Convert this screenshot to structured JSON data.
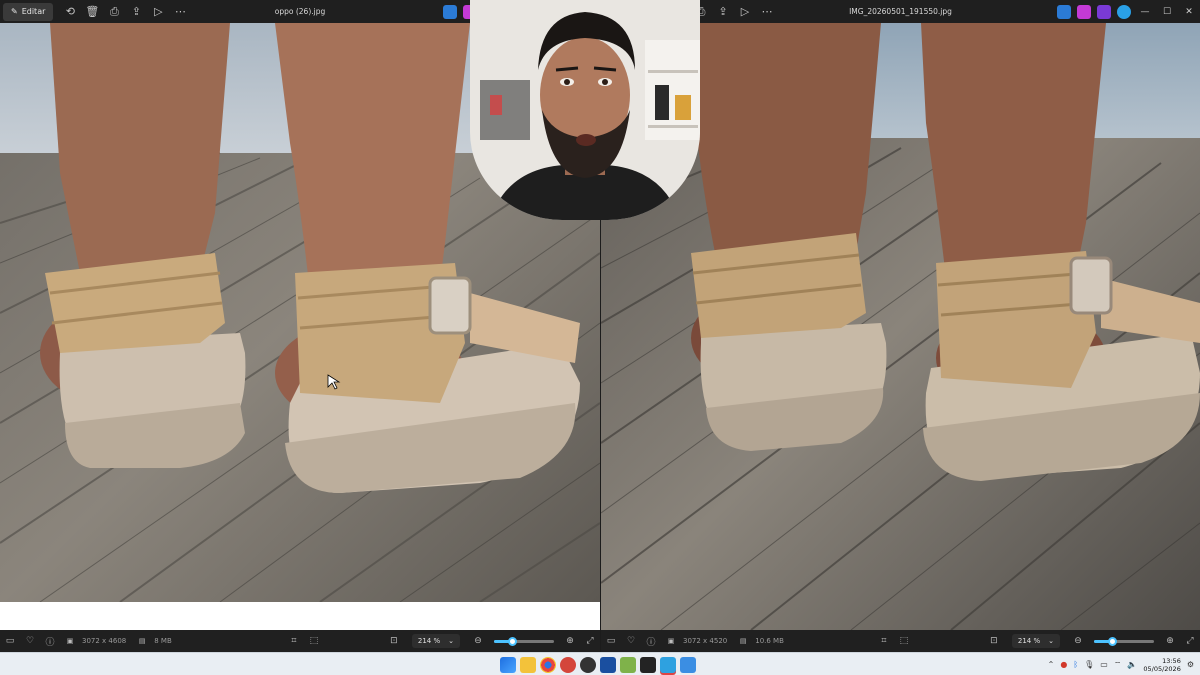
{
  "left_window": {
    "edit_label": "Editar",
    "title": "oppo (26).jpg",
    "dimensions": "3072 x 4608",
    "file_size": "8 MB",
    "zoom": "214 %",
    "zoom_fraction": 0.3
  },
  "right_window": {
    "title": "IMG_20260501_191550.jpg",
    "dimensions": "3072 x 4520",
    "file_size": "10.6 MB",
    "zoom": "214 %",
    "zoom_fraction": 0.3
  },
  "taskbar": {
    "time": "13:56",
    "date": "05/05/2026"
  },
  "colors": {
    "accent": "#4cc2ff",
    "titlebar": "#1f1f1f",
    "taskbar": "#e9eef3"
  }
}
